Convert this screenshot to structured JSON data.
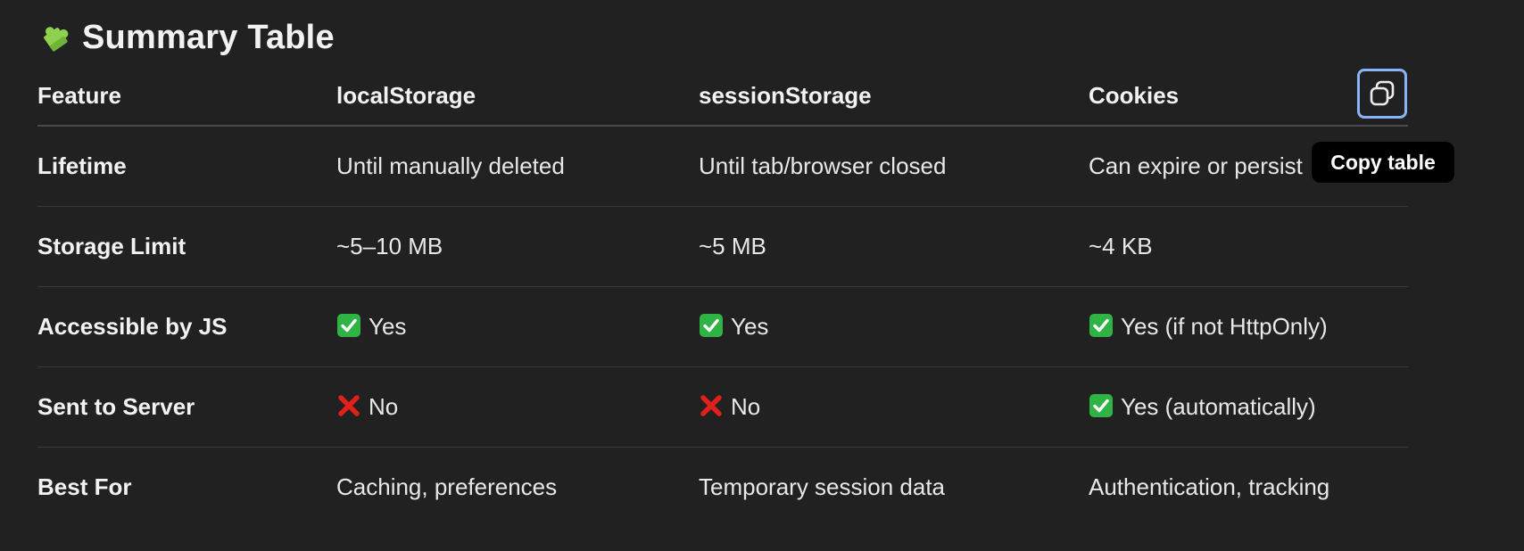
{
  "heading": {
    "icon": "puzzle-piece-icon",
    "title": "Summary Table"
  },
  "table": {
    "columns": [
      "Feature",
      "localStorage",
      "sessionStorage",
      "Cookies"
    ],
    "rows": [
      {
        "feature": "Lifetime",
        "cells": [
          {
            "mark": "",
            "text": "Until manually deleted"
          },
          {
            "mark": "",
            "text": "Until tab/browser closed"
          },
          {
            "mark": "",
            "text": "Can expire or persist"
          }
        ]
      },
      {
        "feature": "Storage Limit",
        "cells": [
          {
            "mark": "",
            "text": "~5–10 MB"
          },
          {
            "mark": "",
            "text": "~5 MB"
          },
          {
            "mark": "",
            "text": "~4 KB"
          }
        ]
      },
      {
        "feature": "Accessible by JS",
        "cells": [
          {
            "mark": "check-mark-icon",
            "text": "Yes"
          },
          {
            "mark": "check-mark-icon",
            "text": "Yes"
          },
          {
            "mark": "check-mark-icon",
            "text": "Yes (if not HttpOnly)"
          }
        ]
      },
      {
        "feature": "Sent to Server",
        "cells": [
          {
            "mark": "cross-mark-icon",
            "text": "No"
          },
          {
            "mark": "cross-mark-icon",
            "text": "No"
          },
          {
            "mark": "check-mark-icon",
            "text": "Yes (automatically)"
          }
        ]
      },
      {
        "feature": "Best For",
        "cells": [
          {
            "mark": "",
            "text": "Caching, preferences"
          },
          {
            "mark": "",
            "text": "Temporary session data"
          },
          {
            "mark": "",
            "text": "Authentication, tracking"
          }
        ]
      }
    ]
  },
  "copy_button": {
    "icon": "copy-icon",
    "tooltip": "Copy table"
  },
  "colors": {
    "background": "#212121",
    "check": "#2fb344",
    "cross": "#e0201b",
    "focus_ring": "#8ab4f8"
  }
}
